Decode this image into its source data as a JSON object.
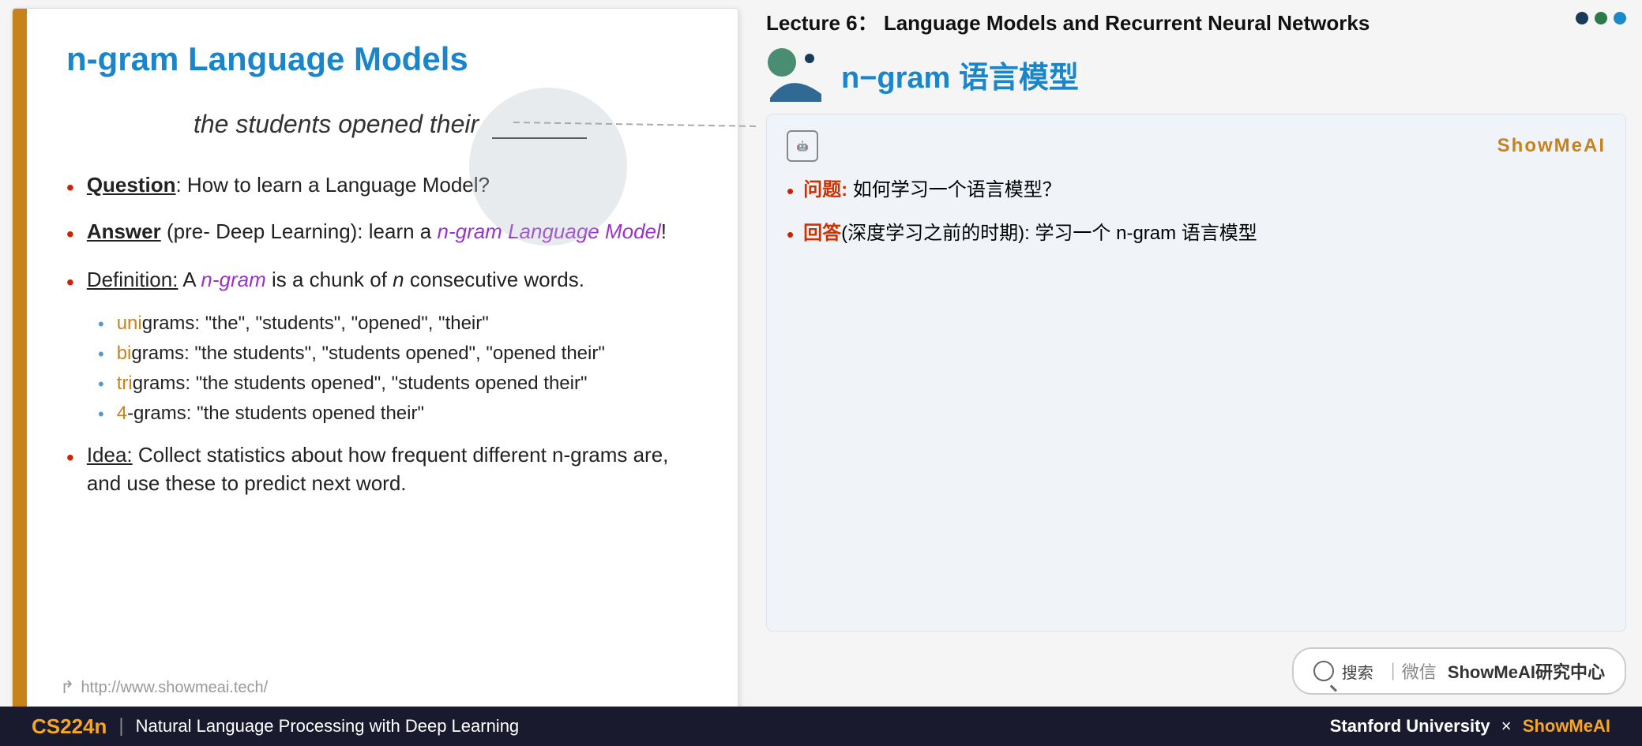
{
  "slide": {
    "accent_color": "#c8821a",
    "title": "n-gram Language Models",
    "sentence_example": "the students opened their",
    "bullets": [
      {
        "id": "question",
        "dot_color": "red",
        "label": "Question",
        "label_style": "bold underline",
        "text": ": How to learn a Language Model?"
      },
      {
        "id": "answer",
        "dot_color": "red",
        "label": "Answer",
        "label_style": "bold underline",
        "text_before": " (pre- Deep Learning): learn a ",
        "highlighted": "n-gram Language Model",
        "highlighted_color": "#9933cc",
        "text_after": "!"
      },
      {
        "id": "definition",
        "dot_color": "red",
        "label": "Definition:",
        "label_style": "underline",
        "text_before": " A ",
        "ngram_italic_purple": "n-gram",
        "text_middle": " is a chunk of ",
        "n_italic": "n",
        "text_after": " consecutive words."
      }
    ],
    "sub_bullets": [
      {
        "prefix_colored": "uni",
        "prefix_color": "#c8821a",
        "rest": "grams: “the”, “students”, “opened”, “their”"
      },
      {
        "prefix_colored": "bi",
        "prefix_color": "#c8821a",
        "rest": "grams: “the students”, “students opened”, “opened their”"
      },
      {
        "prefix_colored": "tri",
        "prefix_color": "#c8821a",
        "rest": "grams: “the students opened”, “students opened their”"
      },
      {
        "prefix_colored": "4",
        "prefix_color": "#c8821a",
        "rest": "-grams: “the students opened their”"
      }
    ],
    "idea_bullet": {
      "label": "Idea:",
      "text": " Collect statistics about how frequent different n-grams are, and use these to predict next word."
    },
    "footer_url": "http://www.showmeai.tech/"
  },
  "right_panel": {
    "lecture_title": "Lecture 6：  Language Models and Recurrent Neural Networks",
    "ngram_title": "n−gram 语言模型",
    "dots": [
      "dark",
      "green-dark",
      "blue"
    ],
    "showmeai_card": {
      "ai_badge": "AI",
      "brand": "ShowMeAI",
      "bullets": [
        {
          "label": "问题:",
          "label_color": "red",
          "text": " 如何学习一个语言模型？"
        },
        {
          "label": "回答",
          "label_color": "red",
          "text_parens": "(深度学习之前的时期):",
          "text": " 学习一个 n-gram 语言模型"
        }
      ]
    },
    "search_bar": {
      "icon": "search",
      "text": "搜索｜微信",
      "brand": "ShowMeAI研究中心"
    }
  },
  "footer": {
    "cs_label": "CS224n",
    "divider": "|",
    "course_title": "Natural Language Processing with Deep Learning",
    "university": "Stanford University",
    "x_symbol": "×",
    "brand": "ShowMeAI"
  }
}
